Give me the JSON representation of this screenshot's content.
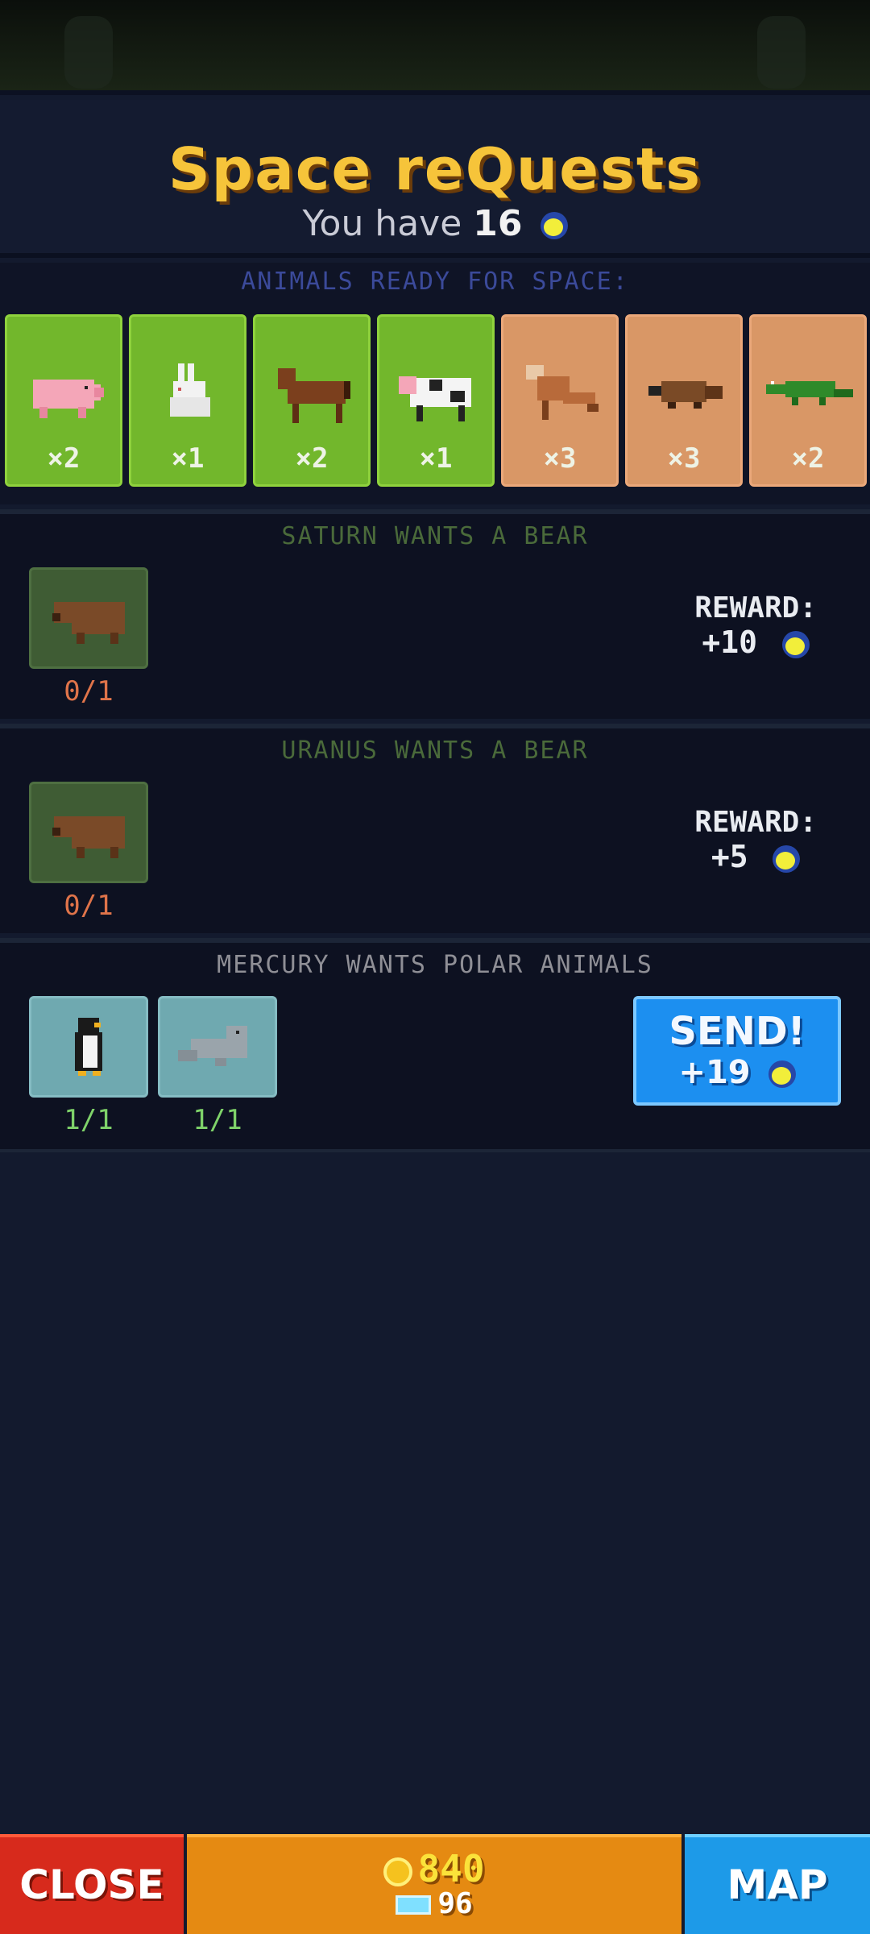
{
  "header": {
    "title": "Space reQuests",
    "you_have_label": "You have",
    "moon_count": "16",
    "currency_icon": "moon-token-icon"
  },
  "ready": {
    "label": "ANIMALS READY FOR SPACE:",
    "animals": [
      {
        "icon": "pig-icon",
        "count": "×2",
        "tile_color": "green"
      },
      {
        "icon": "rabbit-icon",
        "count": "×1",
        "tile_color": "green"
      },
      {
        "icon": "horse-icon",
        "count": "×2",
        "tile_color": "green"
      },
      {
        "icon": "cow-icon",
        "count": "×1",
        "tile_color": "green"
      },
      {
        "icon": "fox-icon",
        "count": "×3",
        "tile_color": "sand"
      },
      {
        "icon": "platypus-icon",
        "count": "×3",
        "tile_color": "sand"
      },
      {
        "icon": "crocodile-icon",
        "count": "×2",
        "tile_color": "sand"
      }
    ]
  },
  "requests": [
    {
      "title": "SATURN WANTS A BEAR",
      "slots": [
        {
          "icon": "bear-icon",
          "progress": "0/1"
        }
      ],
      "reward_label": "REWARD:",
      "reward_value": "+10"
    },
    {
      "title": "URANUS WANTS A BEAR",
      "slots": [
        {
          "icon": "bear-icon",
          "progress": "0/1"
        }
      ],
      "reward_label": "REWARD:",
      "reward_value": "+5"
    },
    {
      "title": "MERCURY WANTS POLAR ANIMALS",
      "slots": [
        {
          "icon": "penguin-icon",
          "progress": "1/1"
        },
        {
          "icon": "seal-icon",
          "progress": "1/1"
        }
      ],
      "send_label": "SEND!",
      "send_reward": "+19"
    }
  ],
  "bottom": {
    "close_label": "CLOSE",
    "coins": "840",
    "gems": "96",
    "map_label": "MAP"
  },
  "colors": {
    "title": "#f6c43a",
    "green_tile": "#72b72c",
    "sand_tile": "#d99766",
    "send_button": "#1c8ff0",
    "close_button": "#d72a1c",
    "map_button": "#1d9ae8",
    "center_bar": "#e58a12"
  }
}
